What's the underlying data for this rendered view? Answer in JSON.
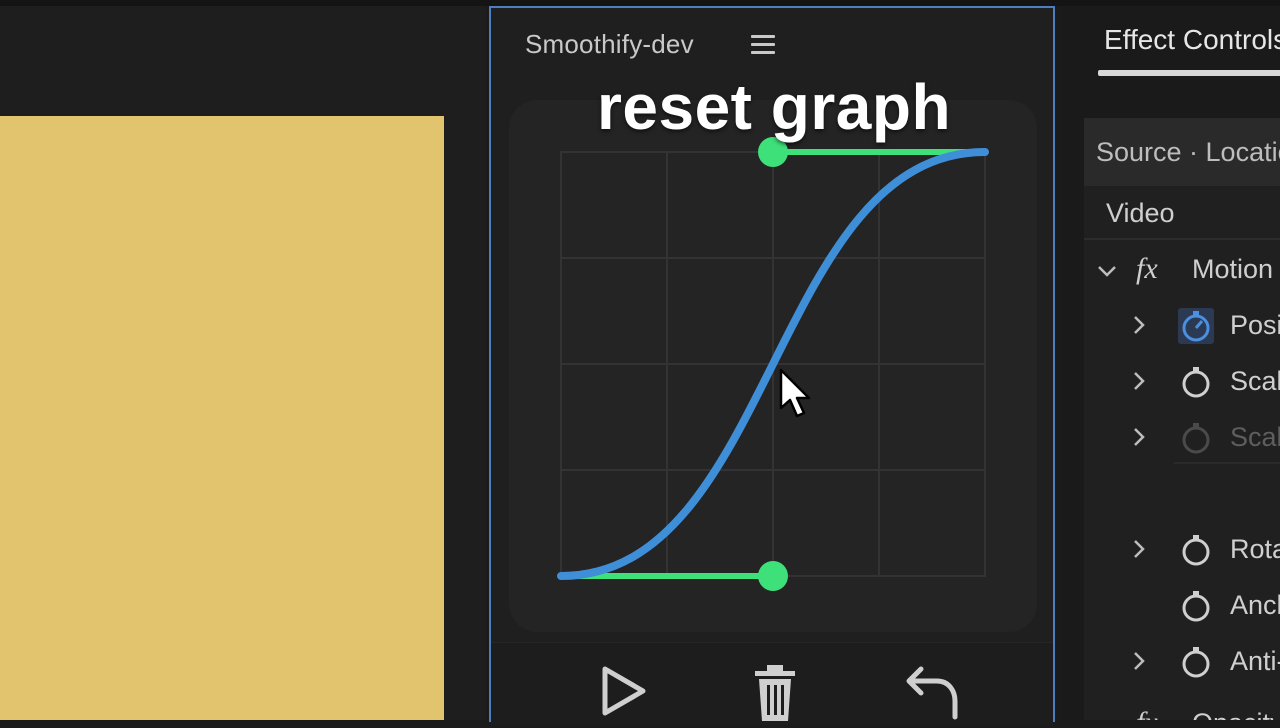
{
  "smoothify_panel": {
    "title": "Smoothify-dev",
    "menu_icon": "hamburger-menu-icon",
    "overlay_caption": "reset graph",
    "graph": {
      "curve_color": "#3f8fd8",
      "handle_color": "#3ee07a",
      "grid_color": "#333333",
      "grid_divisions": 4
    },
    "toolbar": {
      "play_icon": "play-icon",
      "delete_icon": "trash-icon",
      "reset_icon": "undo-arrow-icon"
    }
  },
  "effect_controls": {
    "tab_label": "Effect Controls",
    "source_label": "Source · Location",
    "video_label": "Video",
    "motion_label": "Motion",
    "fx_badge": "fx",
    "properties": [
      {
        "label": "Position",
        "active": true
      },
      {
        "label": "Scale",
        "active": false
      },
      {
        "label": "Scale Width",
        "active": false,
        "disabled": true
      },
      {
        "label": "Rotation",
        "active": false
      },
      {
        "label": "Anchor Point",
        "active": false
      },
      {
        "label": "Anti-flicker Filter",
        "active": false
      }
    ],
    "opacity_label": "Opacity"
  },
  "colors": {
    "accent_border": "#4d7fc0",
    "frame_yellow": "#e2c46e",
    "panel_bg": "#1f1f1f"
  }
}
